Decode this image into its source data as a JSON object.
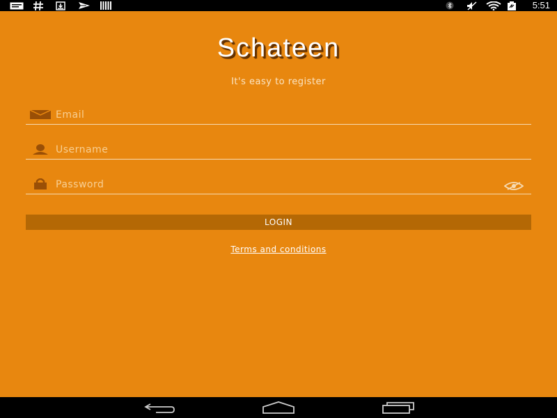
{
  "status_bar": {
    "time": "5:51",
    "left_icons": [
      "message-icon",
      "hashtag-icon",
      "download-icon",
      "airplane-notification-icon",
      "barcode-icon"
    ],
    "right_icons": [
      "bluetooth-icon",
      "mute-icon",
      "wifi-icon",
      "battery-icon"
    ]
  },
  "app": {
    "logo": "Schateen",
    "tagline": "It's easy to register",
    "background_color": "#e8870f",
    "fields": {
      "email": {
        "placeholder": "Email",
        "value": "",
        "icon": "envelope-icon"
      },
      "username": {
        "placeholder": "Username",
        "value": "",
        "icon": "user-icon"
      },
      "password": {
        "placeholder": "Password",
        "value": "",
        "icon": "lock-icon",
        "toggle_icon": "eye-off-icon"
      }
    },
    "login_label": "LOGIN",
    "terms_label": "Terms and conditions"
  },
  "nav_bar": {
    "buttons": [
      "back-icon",
      "home-icon",
      "recents-icon"
    ]
  }
}
